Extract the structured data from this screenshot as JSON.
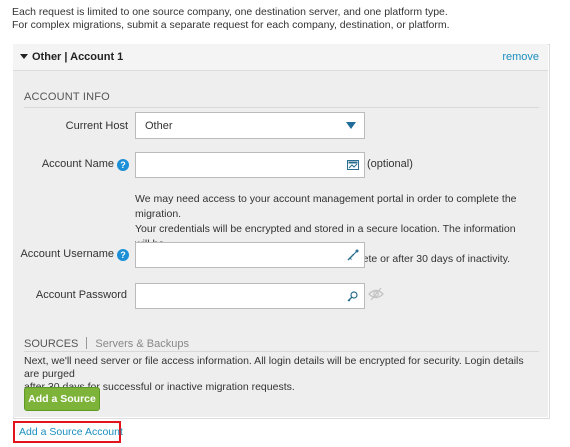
{
  "intro": {
    "line1": "Each request is limited to one source company, one destination server, and one platform type.",
    "line2": "For complex migrations, submit a separate request for each company, destination, or platform."
  },
  "accordion": {
    "title": "Other  |  Account 1",
    "remove_label": "remove"
  },
  "account_info": {
    "section_title": "ACCOUNT INFO",
    "current_host": {
      "label": "Current Host",
      "value": "Other"
    },
    "account_name": {
      "label": "Account Name",
      "value": "",
      "hint": "(optional)"
    },
    "info_line1": "We may need access to your account management portal in order to complete the migration.",
    "info_line2": "Your credentials will be encrypted and stored in a secure location. The information will be",
    "info_line3": "automatically purged once the migration is complete or after 30 days of inactivity.",
    "account_username": {
      "label": "Account Username",
      "value": ""
    },
    "account_password": {
      "label": "Account Password",
      "value": ""
    }
  },
  "sources": {
    "title": "SOURCES",
    "subtitle": "Servers & Backups",
    "text_line1": "Next, we'll need server or file access information. All login details will be encrypted for security. Login details are purged",
    "text_line2": "after 30 days for successful or inactive migration requests.",
    "add_button": "Add a Source"
  },
  "add_source_account_link": "Add a Source Account",
  "colors": {
    "link": "#1a8fbf",
    "button_green": "#7db339",
    "help_blue": "#1c8fd6",
    "highlight_red": "#e3131b",
    "panel_bg": "#eeeeee"
  },
  "icons": {
    "help": "question-circle-icon",
    "caret": "caret-down-icon",
    "select_arrow": "triangle-down-icon",
    "account_name_field": "id-card-icon",
    "username_field": "key-icon",
    "password_field": "key-icon",
    "password_toggle": "eye-off-icon"
  }
}
